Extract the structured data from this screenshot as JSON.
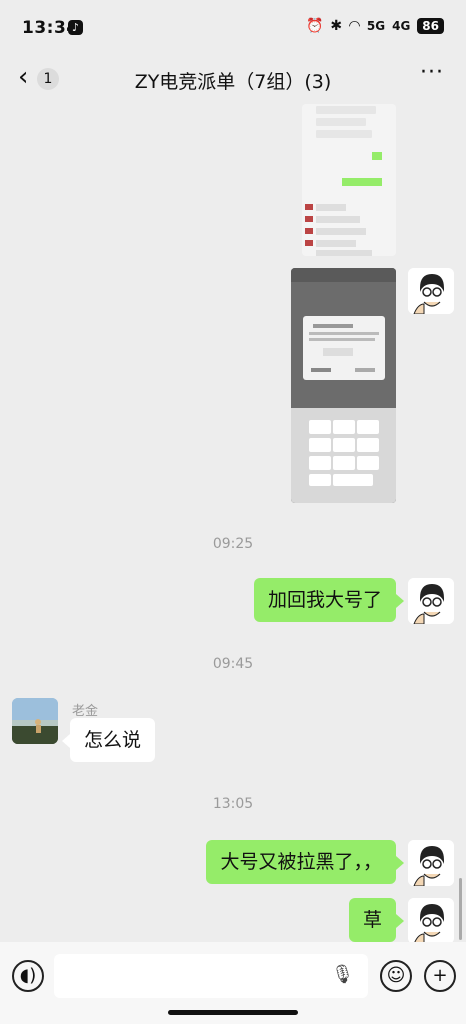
{
  "status_bar": {
    "time": "13:34",
    "battery": "86",
    "signal_1": "5G",
    "signal_2": "4G"
  },
  "header": {
    "back_count": "1",
    "title": "ZY电竞派单（7组）(3)",
    "more": "···"
  },
  "messages": {
    "ts1": "09:25",
    "m1": "加回我大号了",
    "ts2": "09:45",
    "sender_name": "老金",
    "m2": "怎么说",
    "ts3": "13:05",
    "m3": "大号又被拉黑了，，",
    "m4": "草"
  },
  "colors": {
    "self_bubble": "#95ec69",
    "other_bubble": "#ffffff",
    "background": "#ededed"
  }
}
